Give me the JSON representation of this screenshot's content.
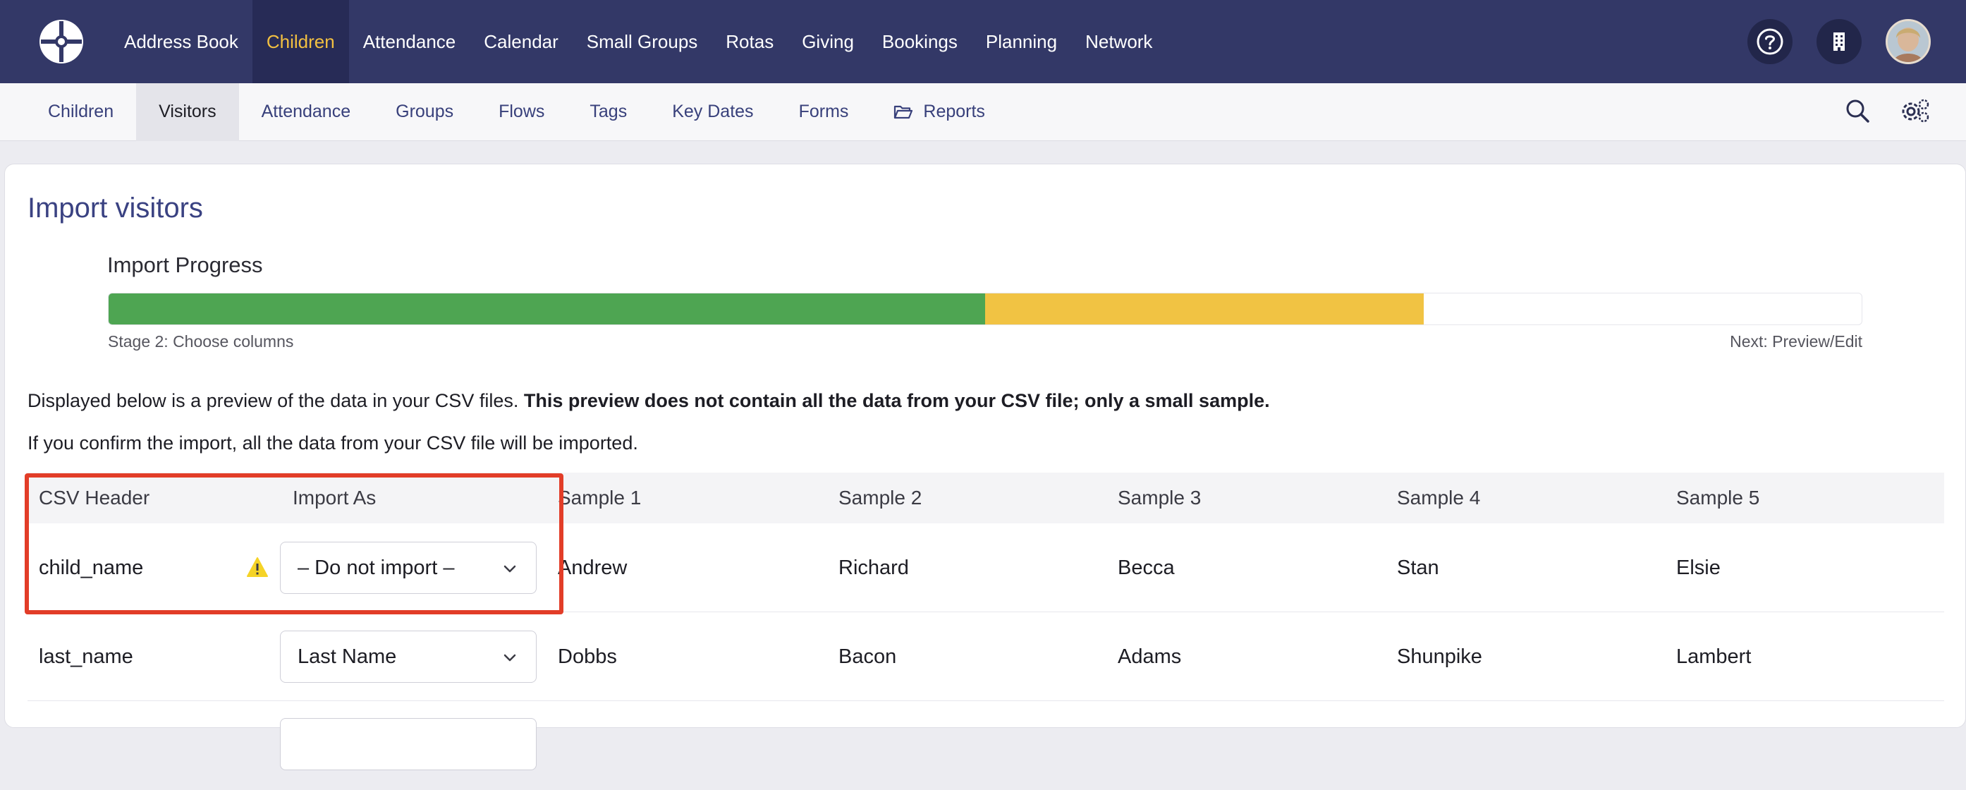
{
  "topnav": {
    "items": [
      {
        "label": "Address Book",
        "active": false
      },
      {
        "label": "Children",
        "active": true
      },
      {
        "label": "Attendance",
        "active": false
      },
      {
        "label": "Calendar",
        "active": false
      },
      {
        "label": "Small Groups",
        "active": false
      },
      {
        "label": "Rotas",
        "active": false
      },
      {
        "label": "Giving",
        "active": false
      },
      {
        "label": "Bookings",
        "active": false
      },
      {
        "label": "Planning",
        "active": false
      },
      {
        "label": "Network",
        "active": false
      }
    ],
    "icons": [
      "help-icon",
      "building-icon",
      "avatar"
    ]
  },
  "subnav": {
    "items": [
      {
        "label": "Children",
        "active": false
      },
      {
        "label": "Visitors",
        "active": true
      },
      {
        "label": "Attendance",
        "active": false
      },
      {
        "label": "Groups",
        "active": false
      },
      {
        "label": "Flows",
        "active": false
      },
      {
        "label": "Tags",
        "active": false
      },
      {
        "label": "Key Dates",
        "active": false
      },
      {
        "label": "Forms",
        "active": false
      },
      {
        "label": "Reports",
        "active": false
      }
    ],
    "icons": [
      "search-icon",
      "settings-icon"
    ]
  },
  "page": {
    "title": "Import visitors",
    "progress": {
      "label": "Import Progress",
      "complete_fraction": 0.5,
      "current_fraction": 0.25,
      "stage": "Stage 2: Choose columns",
      "next": "Next: Preview/Edit"
    },
    "description": {
      "line1_normal": "Displayed below is a preview of the data in your CSV files. ",
      "line1_bold": "This preview does not contain all the data from your CSV file; only a small sample.",
      "line2": "If you confirm the import, all the data from your CSV file will be imported."
    }
  },
  "table": {
    "headers": [
      "CSV Header",
      "Import As",
      "Sample 1",
      "Sample 2",
      "Sample 3",
      "Sample 4",
      "Sample 5"
    ],
    "rows": [
      {
        "header": "child_name",
        "import_as": "– Do not import –",
        "warning": true,
        "samples": [
          "Andrew",
          "Richard",
          "Becca",
          "Stan",
          "Elsie"
        ]
      },
      {
        "header": "last_name",
        "import_as": "Last Name",
        "warning": false,
        "samples": [
          "Dobbs",
          "Bacon",
          "Adams",
          "Shunpike",
          "Lambert"
        ]
      }
    ]
  },
  "colors": {
    "nav_bg": "#333867",
    "nav_active_text": "#f2c041",
    "progress_done": "#4ea552",
    "progress_current": "#f1c343",
    "highlight_border": "#e23d28",
    "title": "#3a4282"
  }
}
